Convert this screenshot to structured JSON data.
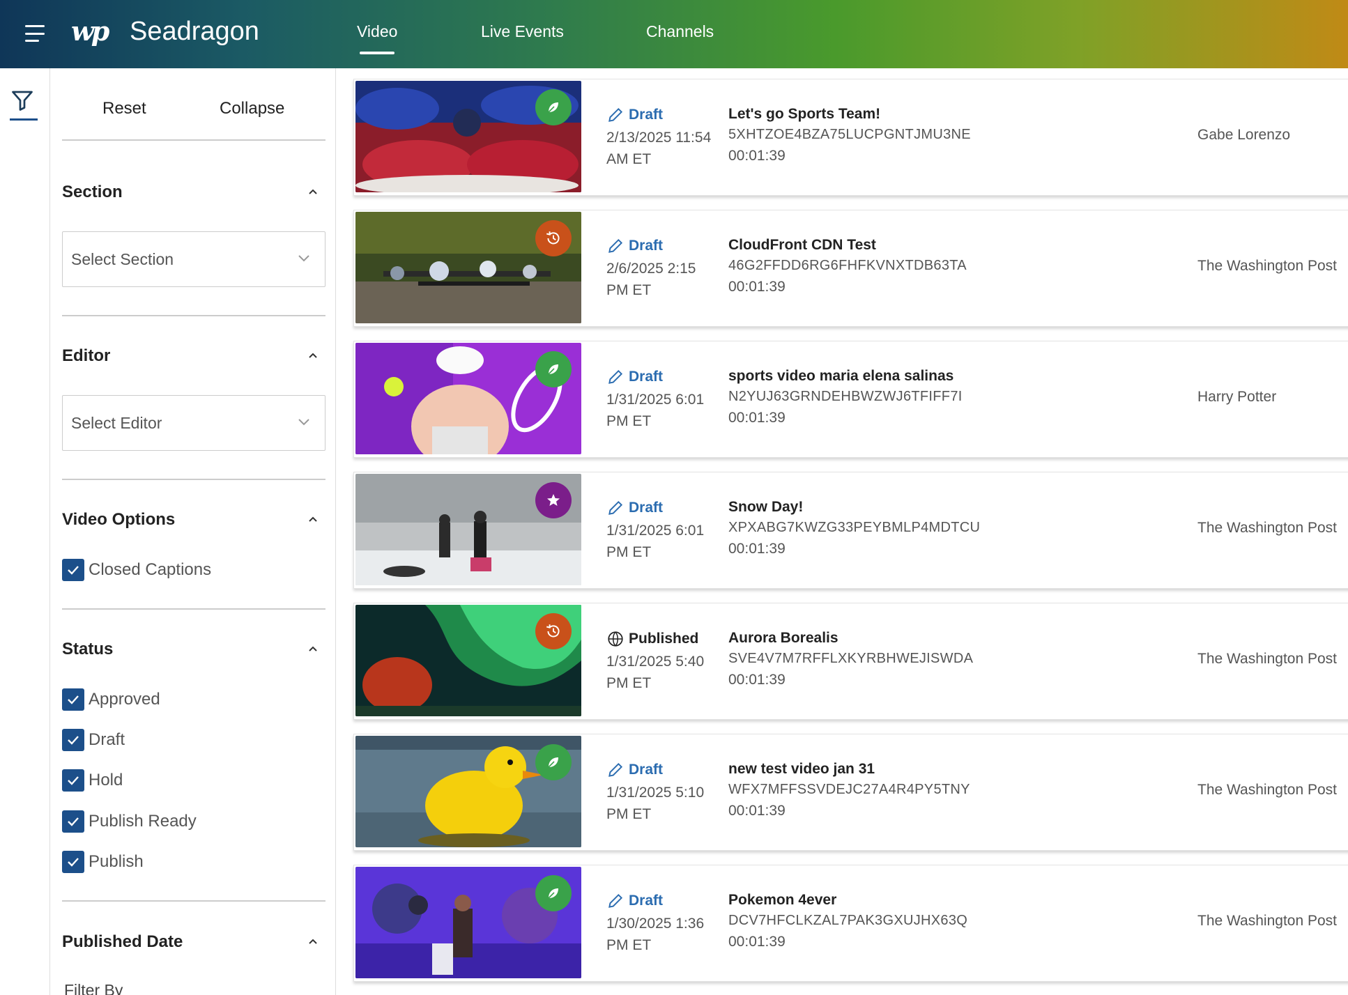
{
  "header": {
    "logo": "wp",
    "app_title": "Seadragon",
    "tabs": [
      {
        "label": "Video",
        "active": true
      },
      {
        "label": "Live Events",
        "active": false
      },
      {
        "label": "Channels",
        "active": false
      }
    ]
  },
  "sidebar": {
    "reset_label": "Reset",
    "collapse_label": "Collapse",
    "section": {
      "heading": "Section",
      "placeholder": "Select Section"
    },
    "editor": {
      "heading": "Editor",
      "placeholder": "Select Editor"
    },
    "video_options": {
      "heading": "Video Options",
      "options": [
        {
          "label": "Closed Captions",
          "checked": true
        }
      ]
    },
    "status": {
      "heading": "Status",
      "options": [
        {
          "label": "Approved",
          "checked": true
        },
        {
          "label": "Draft",
          "checked": true
        },
        {
          "label": "Hold",
          "checked": true
        },
        {
          "label": "Publish Ready",
          "checked": true
        },
        {
          "label": "Publish",
          "checked": true
        }
      ]
    },
    "published_date": {
      "heading": "Published Date",
      "filter_by": "Filter By"
    }
  },
  "videos": [
    {
      "status": "Draft",
      "date": "2/13/2025 11:54 AM ET",
      "title": "Let's go Sports Team!",
      "id": "5XHTZOE4BZA75LUCPGNTJMU3NE",
      "duration": "00:01:39",
      "owner": "Gabe Lorenzo",
      "badge": "leaf-icon"
    },
    {
      "status": "Draft",
      "date": "2/6/2025 2:15 PM ET",
      "title": "CloudFront CDN Test",
      "id": "46G2FFDD6RG6FHFKVNXTDB63TA",
      "duration": "00:01:39",
      "owner": "The Washington Post",
      "badge": "history-icon"
    },
    {
      "status": "Draft",
      "date": "1/31/2025 6:01 PM ET",
      "title": "sports video maria elena salinas",
      "id": "N2YUJ63GRNDEHBWZWJ6TFIFF7I",
      "duration": "00:01:39",
      "owner": "Harry Potter",
      "badge": "leaf-icon"
    },
    {
      "status": "Draft",
      "date": "1/31/2025 6:01 PM ET",
      "title": "Snow Day!",
      "id": "XPXABG7KWZG33PEYBMLP4MDTCU",
      "duration": "00:01:39",
      "owner": "The Washington Post",
      "badge": "star-icon"
    },
    {
      "status": "Published",
      "date": "1/31/2025 5:40 PM ET",
      "title": "Aurora Borealis",
      "id": "SVE4V7M7RFFLXKYRBHWEJISWDA",
      "duration": "00:01:39",
      "owner": "The Washington Post",
      "badge": "history-icon"
    },
    {
      "status": "Draft",
      "date": "1/31/2025 5:10 PM ET",
      "title": "new test video jan 31",
      "id": "WFX7MFFSSVDEJC27A4R4PY5TNY",
      "duration": "00:01:39",
      "owner": "The Washington Post",
      "badge": "leaf-icon"
    },
    {
      "status": "Draft",
      "date": "1/30/2025 1:36 PM ET",
      "title": "Pokemon 4ever",
      "id": "DCV7HFCLKZAL7PAK3GXUJHX63Q",
      "duration": "00:01:39",
      "owner": "The Washington Post",
      "badge": "leaf-icon"
    }
  ],
  "colors": {
    "primary_blue": "#1c4f8a",
    "draft_blue": "#2b6cb0",
    "badge_green": "#3aa24a",
    "badge_orange": "#c9511a",
    "badge_purple": "#7b1e8a"
  }
}
